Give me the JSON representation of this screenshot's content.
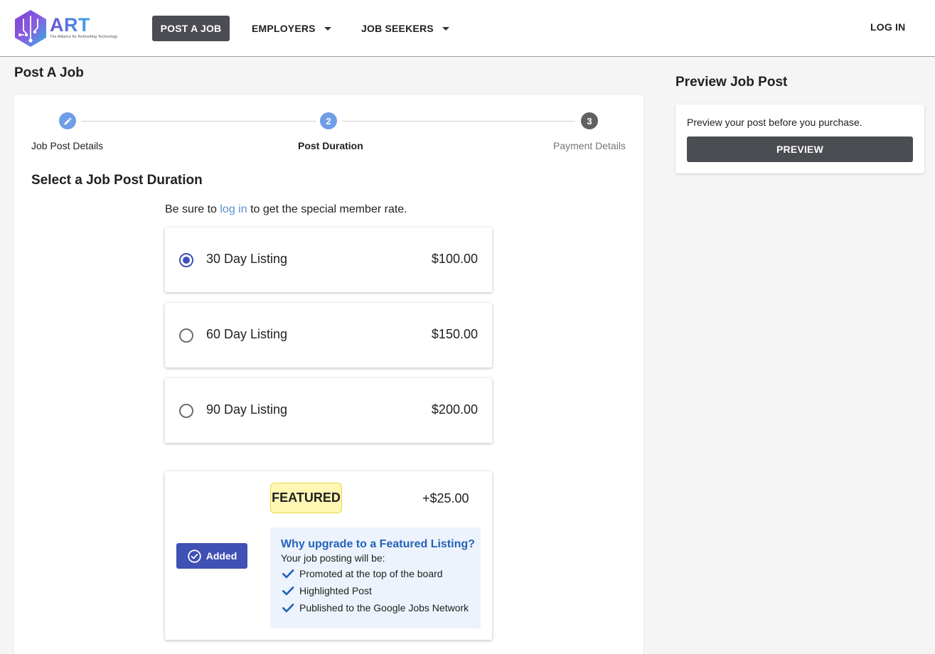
{
  "header": {
    "logo_text": "ART",
    "logo_tagline": "The Alliance for Refreshing Technology",
    "nav": {
      "post_job": "POST A JOB",
      "employers": "EMPLOYERS",
      "job_seekers": "JOB SEEKERS",
      "login": "LOG IN"
    }
  },
  "page": {
    "title": "Post A Job",
    "preview_title": "Preview Job Post"
  },
  "stepper": {
    "steps": [
      {
        "label": "Job Post Details",
        "icon": "pencil-icon",
        "state": "completed"
      },
      {
        "label": "Post Duration",
        "number": "2",
        "state": "active"
      },
      {
        "label": "Payment Details",
        "number": "3",
        "state": "upcoming"
      }
    ],
    "colors": {
      "completed": "#6f9de8",
      "active": "#6f9de8",
      "upcoming": "#616161"
    }
  },
  "duration": {
    "title": "Select a Job Post Duration",
    "member_note_prefix": "Be sure to ",
    "member_note_link": "log in",
    "member_note_suffix": " to get the special member rate.",
    "options": [
      {
        "label": "30 Day Listing",
        "price": "$100.00",
        "selected": true
      },
      {
        "label": "60 Day Listing",
        "price": "$150.00",
        "selected": false
      },
      {
        "label": "90 Day Listing",
        "price": "$200.00",
        "selected": false
      }
    ]
  },
  "featured": {
    "badge": "FEATURED",
    "price": "+$25.00",
    "button_label": "Added",
    "why_title": "Why upgrade to a Featured Listing?",
    "why_sub": "Your job posting will be:",
    "benefits": [
      "Promoted at the top of the board",
      "Highlighted Post",
      "Published to the Google Jobs Network"
    ],
    "accent_color": "#3f51b5",
    "check_color": "#2563b8"
  },
  "preview": {
    "text": "Preview your post before you purchase.",
    "button": "PREVIEW"
  }
}
